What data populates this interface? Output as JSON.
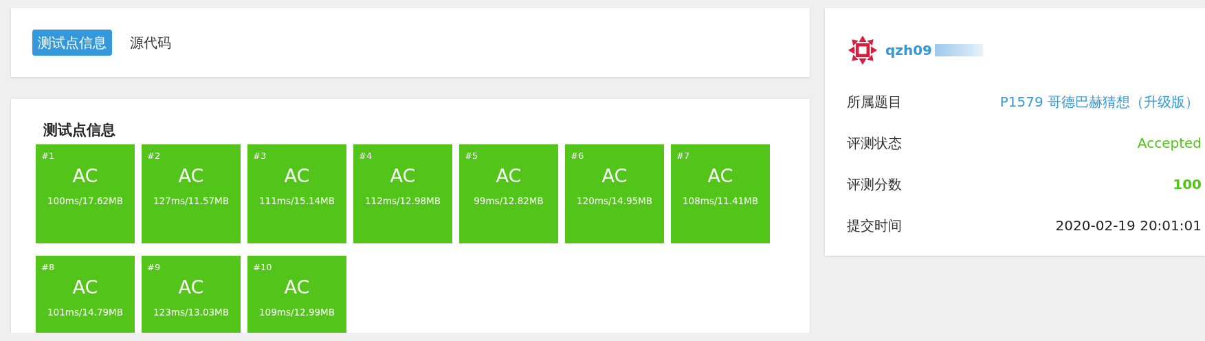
{
  "tabs": [
    {
      "label": "测试点信息",
      "selected": true
    },
    {
      "label": "源代码",
      "selected": false
    }
  ],
  "testcases": {
    "title": "测试点信息",
    "items": [
      {
        "label": "#1",
        "status": "AC",
        "usage": "100ms/17.62MB"
      },
      {
        "label": "#2",
        "status": "AC",
        "usage": "127ms/11.57MB"
      },
      {
        "label": "#3",
        "status": "AC",
        "usage": "111ms/15.14MB"
      },
      {
        "label": "#4",
        "status": "AC",
        "usage": "112ms/12.98MB"
      },
      {
        "label": "#5",
        "status": "AC",
        "usage": "99ms/12.82MB"
      },
      {
        "label": "#6",
        "status": "AC",
        "usage": "120ms/14.95MB"
      },
      {
        "label": "#7",
        "status": "AC",
        "usage": "108ms/11.41MB"
      },
      {
        "label": "#8",
        "status": "AC",
        "usage": "101ms/14.79MB"
      },
      {
        "label": "#9",
        "status": "AC",
        "usage": "123ms/13.03MB"
      },
      {
        "label": "#10",
        "status": "AC",
        "usage": "109ms/12.99MB"
      }
    ]
  },
  "submission": {
    "user": "qzh09",
    "details": [
      {
        "label": "所属题目",
        "value": "P1579 哥德巴赫猜想（升级版）",
        "kind": "link"
      },
      {
        "label": "评测状态",
        "value": "Accepted",
        "kind": "status"
      },
      {
        "label": "评测分数",
        "value": "100",
        "kind": "score"
      },
      {
        "label": "提交时间",
        "value": "2020-02-19 20:01:01",
        "kind": "text"
      }
    ]
  }
}
